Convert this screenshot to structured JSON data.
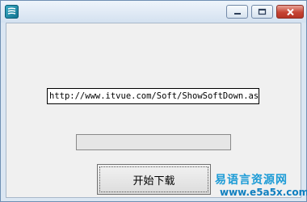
{
  "window": {
    "title": "",
    "controls": {
      "minimize": "minimize-icon",
      "maximize": "maximize-icon",
      "close": "close-icon"
    }
  },
  "form": {
    "url_value": "http://www.itvue.com/Soft/ShowSoftDown.asp?",
    "progress_percent": 0,
    "download_label": "开始下载"
  },
  "watermark": {
    "title": "易语言资源网",
    "url": "www.e5a5x.com"
  },
  "colors": {
    "accent": "#1c9bd6",
    "close": "#c64434"
  }
}
